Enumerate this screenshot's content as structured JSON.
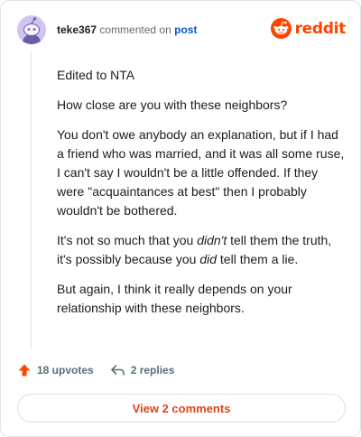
{
  "comment": {
    "author": "teke367",
    "verb": "commented on",
    "post_label": "post",
    "paragraphs": [
      [
        {
          "text": "Edited to NTA"
        }
      ],
      [
        {
          "text": "How close are you with these neighbors?"
        }
      ],
      [
        {
          "text": "You don't owe anybody an explanation, but if I had a friend who was married, and it was all some ruse, I can't say I wouldn't be a little offended. If they were \"acquaintances at best\" then I probably wouldn't be bothered."
        }
      ],
      [
        {
          "text": "It's not so much that you "
        },
        {
          "text": "didn't",
          "em": true
        },
        {
          "text": " tell them the truth, it's possibly because you "
        },
        {
          "text": "did",
          "em": true
        },
        {
          "text": " tell them a lie."
        }
      ],
      [
        {
          "text": "But again, I think it really depends on your relationship with these neighbors."
        }
      ]
    ]
  },
  "brand": {
    "wordmark": "reddit",
    "icon": "reddit-snoo-icon",
    "color": "#ff4500"
  },
  "actions": {
    "upvotes_label": "18 upvotes",
    "upvote_icon": "upvote-arrow-icon",
    "upvote_color": "#ff4500",
    "replies_label": "2 replies",
    "reply_icon": "reply-arrow-icon"
  },
  "view_comments_label": "View 2 comments",
  "colors": {
    "accent": "#e0431c",
    "link": "#0a59c4",
    "avatar_bg": "#d4c2f2"
  }
}
